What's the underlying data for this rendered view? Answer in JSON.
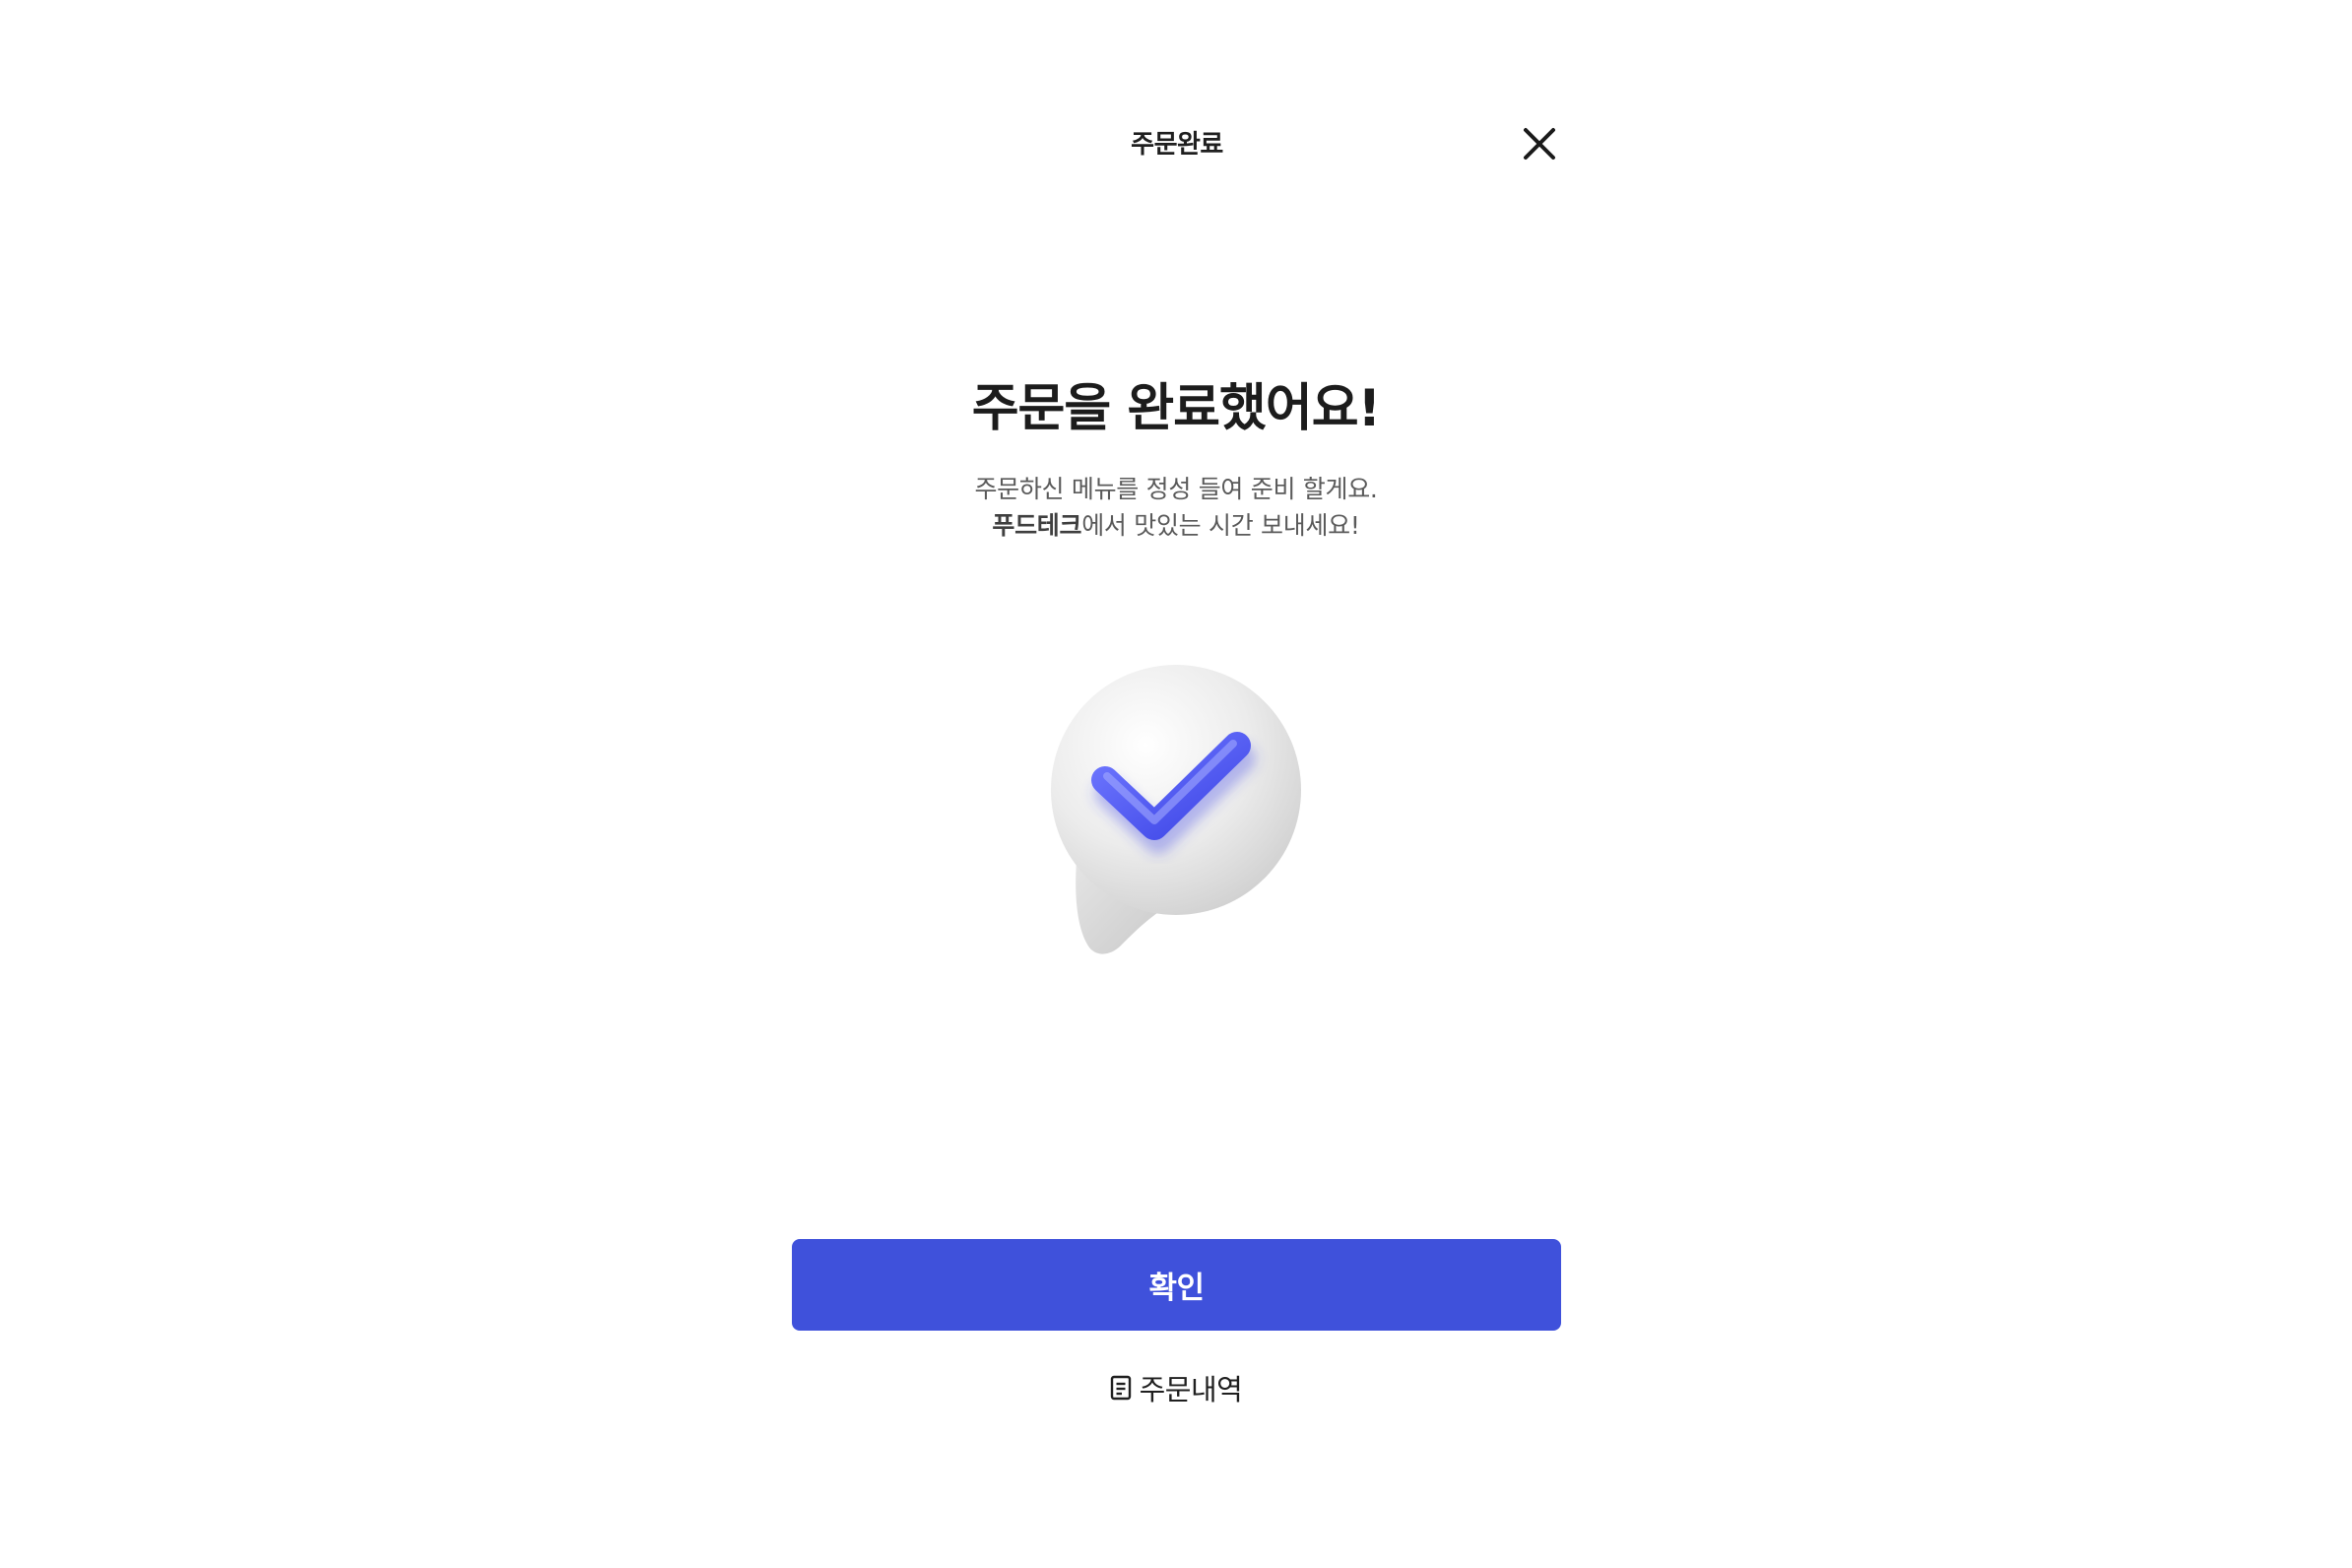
{
  "header": {
    "title": "주문완료",
    "close_icon": "close-icon"
  },
  "main": {
    "headline": "주문을 완료했어요!",
    "subtext_line1": "주문하신 메뉴를 정성 들여 준비 할게요.",
    "subtext_brand": "푸드테크",
    "subtext_line2_rest": "에서 맛있는 시간 보내세요!",
    "illustration_icon": "check-bubble-icon"
  },
  "actions": {
    "confirm_label": "확인",
    "history_label": "주문내역",
    "history_icon": "receipt-icon"
  },
  "colors": {
    "primary": "#3f51db",
    "check": "#4a55f0",
    "text_dark": "#1c1c1c",
    "text_muted": "#5a5a5a",
    "background": "#ffffff"
  }
}
